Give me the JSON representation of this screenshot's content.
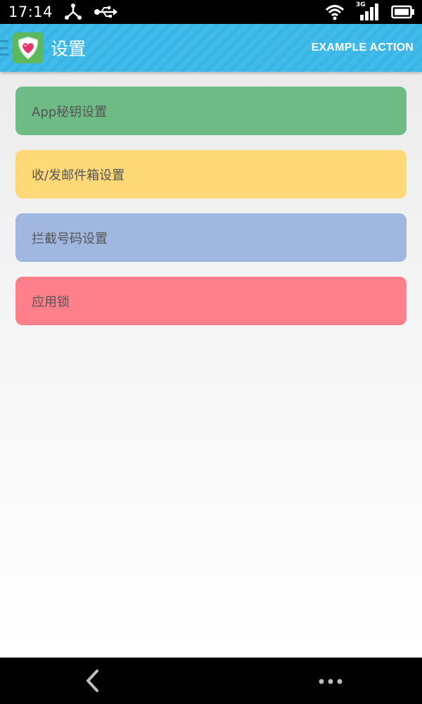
{
  "status_bar": {
    "time": "17:14",
    "icons": [
      "share-icon",
      "usb-icon",
      "wifi-icon",
      "3g-signal-icon",
      "battery-icon"
    ],
    "network": "3G"
  },
  "action_bar": {
    "title": "设置",
    "action_label": "EXAMPLE ACTION",
    "logo_icon": "heart-shield-icon",
    "background_color": "#3bb6e7"
  },
  "settings": {
    "items": [
      {
        "label": "App秘钥设置",
        "color": "#6ebb85"
      },
      {
        "label": "收/发邮件箱设置",
        "color": "#ffd877"
      },
      {
        "label": "拦截号码设置",
        "color": "#a0b8e0"
      },
      {
        "label": "应用锁",
        "color": "#ff7f8a"
      }
    ]
  },
  "nav_bar": {
    "icons": [
      "back-icon",
      "menu-dots-icon"
    ]
  }
}
